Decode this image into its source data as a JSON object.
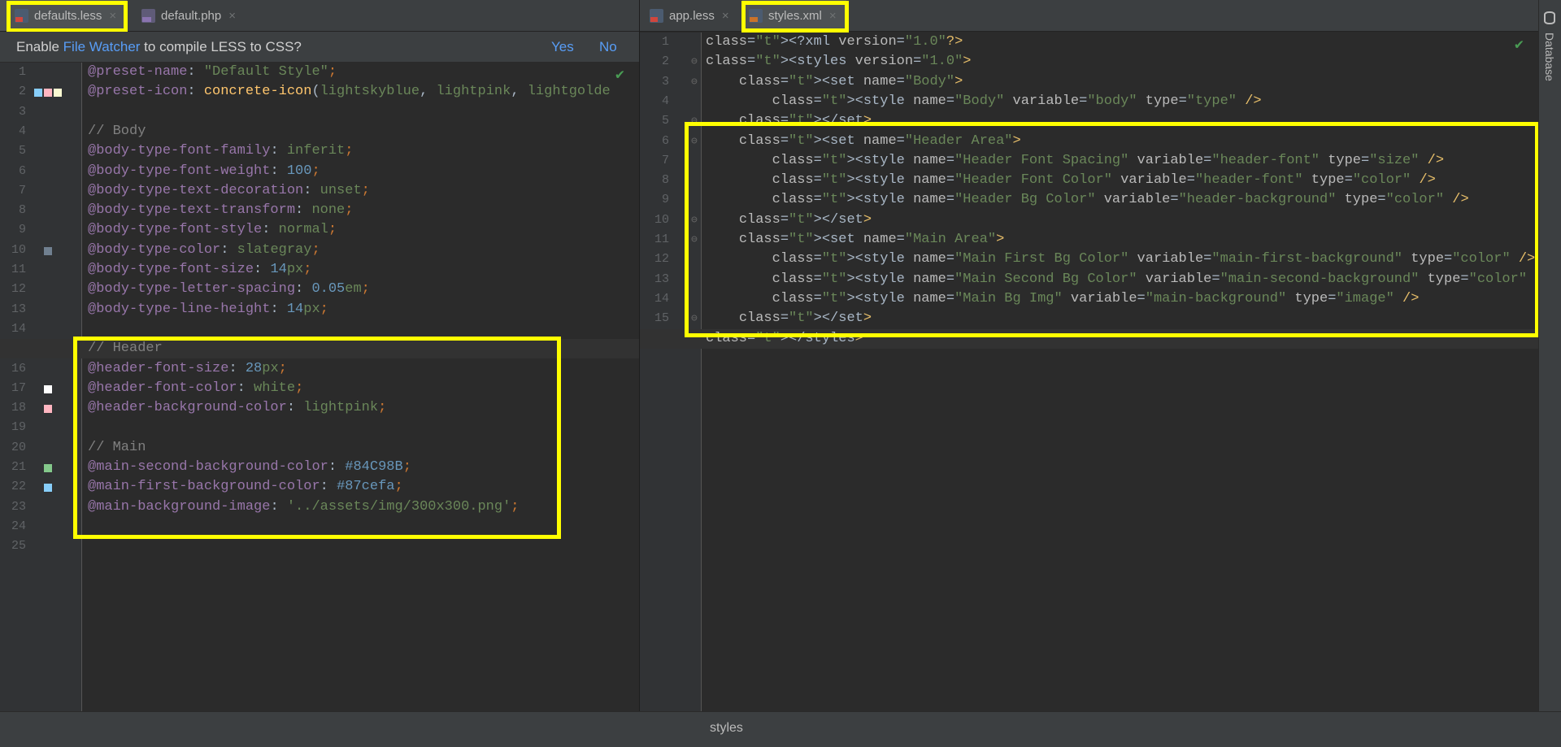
{
  "left_tabs": [
    {
      "label": "defaults.less",
      "icon": "less-file-icon",
      "active": true
    },
    {
      "label": "default.php",
      "icon": "php-file-icon",
      "active": false
    }
  ],
  "right_tabs": [
    {
      "label": "app.less",
      "icon": "less-file-icon",
      "active": false
    },
    {
      "label": "styles.xml",
      "icon": "xml-file-icon",
      "active": true
    }
  ],
  "close_glyph": "×",
  "notification": {
    "prefix": "Enable ",
    "link": "File Watcher",
    "suffix": " to compile LESS to CSS?",
    "yes": "Yes",
    "no": "No"
  },
  "left_editor": {
    "current_line": 15,
    "swatch_colors": {
      "2": [
        "#87cefa",
        "#ffb6c1",
        "#fafad2"
      ],
      "10": [
        "#708090"
      ],
      "17": [
        "#ffffff"
      ],
      "18": [
        "#ffb6c1"
      ],
      "21": [
        "#84C98B"
      ],
      "22": [
        "#87cefa"
      ]
    },
    "lines": [
      "@preset-name: \"Default Style\";",
      "@preset-icon: concrete-icon(lightskyblue, lightpink, lightgolde",
      "",
      "// Body",
      "@body-type-font-family: inferit;",
      "@body-type-font-weight: 100;",
      "@body-type-text-decoration: unset;",
      "@body-type-text-transform: none;",
      "@body-type-font-style: normal;",
      "@body-type-color: slategray;",
      "@body-type-font-size: 14px;",
      "@body-type-letter-spacing: 0.05em;",
      "@body-type-line-height: 14px;",
      "",
      "// Header",
      "@header-font-size: 28px;",
      "@header-font-color: white;",
      "@header-background-color: lightpink;",
      "",
      "// Main",
      "@main-second-background-color: #84C98B;",
      "@main-first-background-color: #87cefa;",
      "@main-background-image: '../assets/img/300x300.png';",
      "",
      ""
    ]
  },
  "right_editor": {
    "current_line": 16,
    "fold_lines": [
      2,
      3,
      5,
      6,
      10,
      11,
      15,
      16
    ],
    "lines": [
      "<?xml version=\"1.0\"?>",
      "<styles version=\"1.0\">",
      "    <set name=\"Body\">",
      "        <style name=\"Body\" variable=\"body\" type=\"type\" />",
      "    </set>",
      "    <set name=\"Header Area\">",
      "        <style name=\"Header Font Spacing\" variable=\"header-font\" type=\"size\" />",
      "        <style name=\"Header Font Color\" variable=\"header-font\" type=\"color\" />",
      "        <style name=\"Header Bg Color\" variable=\"header-background\" type=\"color\" />",
      "    </set>",
      "    <set name=\"Main Area\">",
      "        <style name=\"Main First Bg Color\" variable=\"main-first-background\" type=\"color\" />",
      "        <style name=\"Main Second Bg Color\" variable=\"main-second-background\" type=\"color\" />",
      "        <style name=\"Main Bg Img\" variable=\"main-background\" type=\"image\" />",
      "    </set>",
      "</styles>"
    ]
  },
  "inspection_icon": "checkmark-icon",
  "sidebar": {
    "label": "Database",
    "icon": "database-icon"
  },
  "status_bar": {
    "breadcrumb": "styles"
  },
  "highlight_color": "#ffff00"
}
